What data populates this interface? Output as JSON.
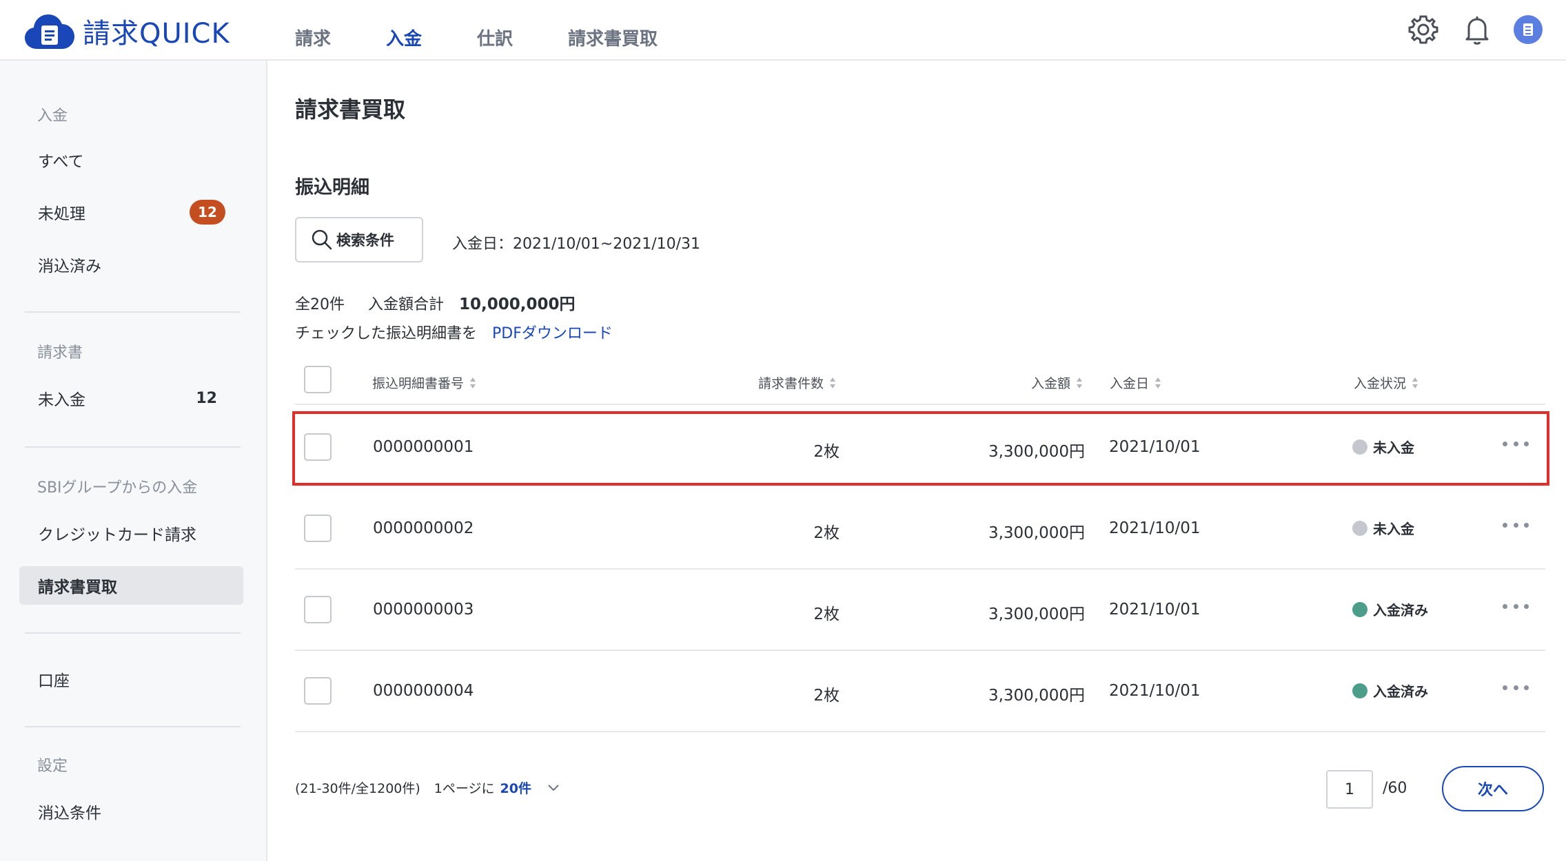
{
  "app": {
    "name": "請求QUICK"
  },
  "nav": [
    {
      "label": "請求",
      "active": false
    },
    {
      "label": "入金",
      "active": true
    },
    {
      "label": "仕訳",
      "active": false
    },
    {
      "label": "請求書買取",
      "active": false
    }
  ],
  "header_icons": [
    "gear-icon",
    "bell-icon",
    "avatar"
  ],
  "sidebar": {
    "sections": [
      {
        "title": "入金",
        "items": [
          {
            "label": "すべて"
          },
          {
            "label": "未処理",
            "badge": "12"
          },
          {
            "label": "消込済み"
          }
        ]
      },
      {
        "title": "請求書",
        "items": [
          {
            "label": "未入金",
            "count": "12"
          }
        ]
      },
      {
        "title": "SBIグループからの入金",
        "items": [
          {
            "label": "クレジットカード請求"
          },
          {
            "label": "請求書買取",
            "active": true
          }
        ]
      },
      {
        "title": "",
        "items": [
          {
            "label": "口座"
          }
        ]
      },
      {
        "title": "設定",
        "items": [
          {
            "label": "消込条件"
          }
        ]
      }
    ]
  },
  "main": {
    "page_title": "請求書買取",
    "sub_title": "振込明細",
    "search_label": "検索条件",
    "filter_text": "入金日：2021/10/01~2021/10/31",
    "summary": {
      "count_label": "全20件",
      "total_label": "入金額合計",
      "total_value": "10,000,000円"
    },
    "download": {
      "prefix": "チェックした振込明細書を",
      "link": "PDFダウンロード"
    }
  },
  "table": {
    "columns": {
      "number": "振込明細書番号",
      "invoices": "請求書件数",
      "amount": "入金額",
      "date": "入金日",
      "status": "入金状況"
    },
    "rows": [
      {
        "number": "0000000001",
        "invoices": "2枚",
        "amount": "3,300,000円",
        "date": "2021/10/01",
        "status": "未入金",
        "status_color": "#c4c8ce"
      },
      {
        "number": "0000000002",
        "invoices": "2枚",
        "amount": "3,300,000円",
        "date": "2021/10/01",
        "status": "未入金",
        "status_color": "#c4c8ce"
      },
      {
        "number": "0000000003",
        "invoices": "2枚",
        "amount": "3,300,000円",
        "date": "2021/10/01",
        "status": "入金済み",
        "status_color": "#4c9e8a"
      },
      {
        "number": "0000000004",
        "invoices": "2枚",
        "amount": "3,300,000円",
        "date": "2021/10/01",
        "status": "入金済み",
        "status_color": "#4c9e8a"
      }
    ]
  },
  "pagination": {
    "range": "(21-30件/全1200件)",
    "per_page_label": "1ページに",
    "per_page_value": "20件",
    "current_page": "1",
    "total_pages": "/60",
    "next_label": "次へ"
  },
  "colors": {
    "accent": "#1a47b8",
    "badge": "#c44e1f",
    "highlight": "#e02e2a"
  }
}
